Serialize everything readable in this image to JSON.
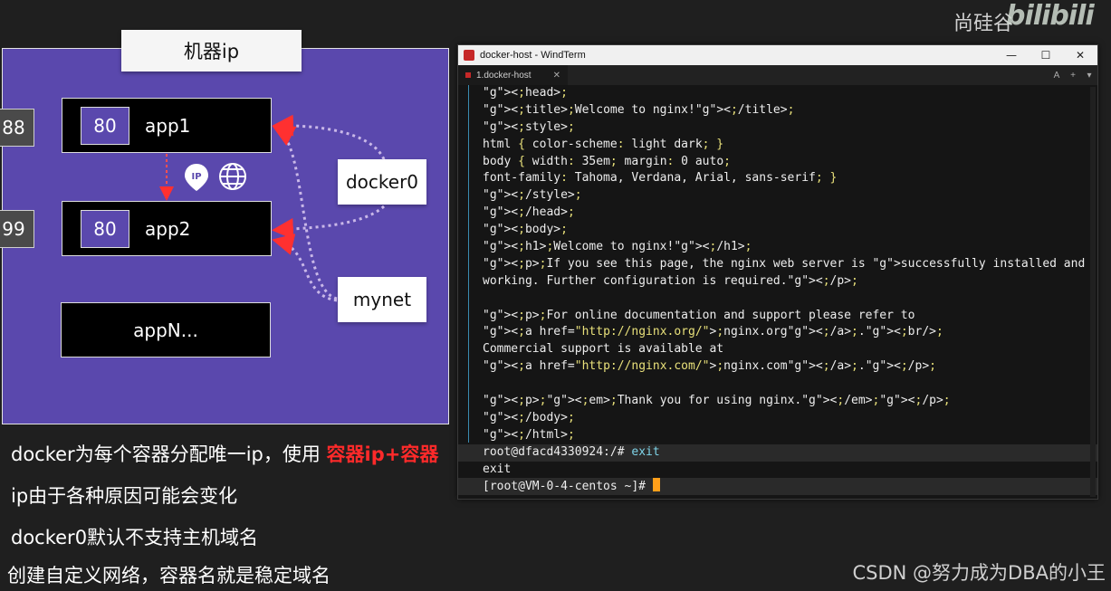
{
  "diagram": {
    "title": "机器ip",
    "side_numbers": [
      "88",
      "99"
    ],
    "apps": [
      {
        "port": "80",
        "name": "app1"
      },
      {
        "port": "80",
        "name": "app2"
      },
      {
        "name": "appN..."
      }
    ],
    "networks": [
      "docker0",
      "mynet"
    ],
    "icons": [
      "ip-location-icon",
      "globe-icon"
    ]
  },
  "bullets": [
    {
      "text": "docker为每个容器分配唯一ip，使用 ",
      "highlight": "容器ip+容器"
    },
    {
      "text": "ip由于各种原因可能会变化"
    },
    {
      "text": "docker0默认不支持主机域名"
    },
    {
      "text": "创建自定义网络，容器名就是稳定域名"
    }
  ],
  "branding": {
    "publisher": "尚硅谷",
    "platform": "bilibili",
    "watermark": "CSDN @努力成为DBA的小王"
  },
  "window": {
    "title": "docker-host - WindTerm",
    "controls": [
      "—",
      "☐",
      "✕"
    ],
    "tab": {
      "label": "1.docker-host",
      "close": "✕"
    },
    "tab_controls": [
      "A",
      "+",
      "▾"
    ]
  },
  "terminal": {
    "lines": [
      "<head>",
      "<title>Welcome to nginx!</title>",
      "<style>",
      "html { color-scheme: light dark; }",
      "body { width: 35em; margin: 0 auto;",
      "font-family: Tahoma, Verdana, Arial, sans-serif; }",
      "</style>",
      "</head>",
      "<body>",
      "<h1>Welcome to nginx!</h1>",
      "<p>If you see this page, the nginx web server is successfully installed and",
      "working. Further configuration is required.</p>",
      "",
      "<p>For online documentation and support please refer to",
      "<a href=\"http://nginx.org/\">nginx.org</a>.<br/>",
      "Commercial support is available at",
      "<a href=\"http://nginx.com/\">nginx.com</a>.</p>",
      "",
      "<p><em>Thank you for using nginx.</em></p>",
      "</body>",
      "</html>"
    ],
    "prompt1": "root@dfacd4330924:/# ",
    "cmd1": "exit",
    "output": "exit",
    "prompt2": "[root@VM-0-4-centos ~]# "
  },
  "colors": {
    "diagram_bg": "#5a48ad",
    "highlight": "#ff2a2a",
    "cursor": "#ff9f1a",
    "terminal_bg": "#151515"
  }
}
